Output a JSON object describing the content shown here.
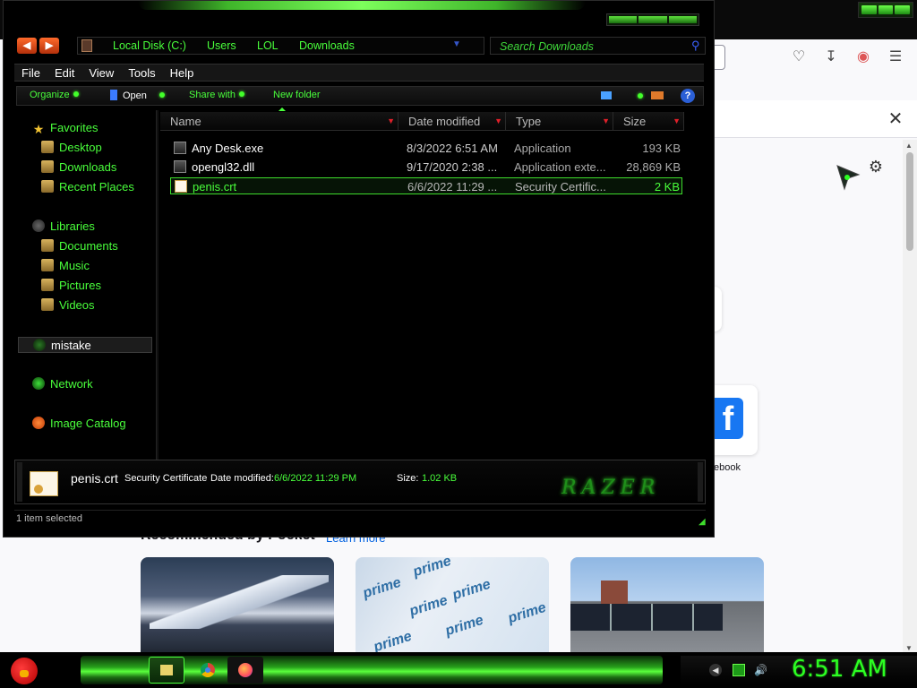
{
  "browser": {
    "facebook_label": "ebook",
    "pocket_heading": "Recommended by Pocket",
    "pocket_learn_more": "Learn more",
    "card2_brand": "prime",
    "icons": [
      "pocket-icon",
      "download-icon",
      "account-icon",
      "menu-icon",
      "close-icon",
      "gear-icon"
    ]
  },
  "explorer": {
    "address": {
      "crumbs": [
        "Local Disk (C:)",
        "Users",
        "LOL",
        "Downloads"
      ]
    },
    "search": {
      "placeholder": "Search Downloads"
    },
    "menu": [
      "File",
      "Edit",
      "View",
      "Tools",
      "Help"
    ],
    "commands": {
      "organize": "Organize",
      "open": "Open",
      "share_with": "Share with",
      "new_folder": "New folder",
      "help": "?"
    },
    "nav": {
      "favorites": "Favorites",
      "desktop": "Desktop",
      "downloads": "Downloads",
      "recent_places": "Recent Places",
      "libraries": "Libraries",
      "documents": "Documents",
      "music": "Music",
      "pictures": "Pictures",
      "videos": "Videos",
      "mistake": "mistake",
      "network": "Network",
      "image_catalog": "Image Catalog"
    },
    "columns": [
      "Name",
      "Date modified",
      "Type",
      "Size"
    ],
    "files": [
      {
        "name": "Any Desk.exe",
        "date": "8/3/2022 6:51 AM",
        "type": "Application",
        "size": "193 KB"
      },
      {
        "name": "opengl32.dll",
        "date": "9/17/2020 2:38 ...",
        "type": "Application exte...",
        "size": "28,869 KB"
      },
      {
        "name": "penis.crt",
        "date": "6/6/2022 11:29 ...",
        "type": "Security Certific...",
        "size": "2 KB"
      }
    ],
    "details": {
      "name": "penis.crt",
      "type": "Security Certificate",
      "date_label": "Date modified:",
      "date_value": "6/6/2022 11:29 PM",
      "size_label": "Size:",
      "size_value": "1.02 KB",
      "brand": "RAZER"
    },
    "status": "1 item selected"
  },
  "taskbar": {
    "clock": "6:51 AM",
    "accent": "#2cff22"
  }
}
